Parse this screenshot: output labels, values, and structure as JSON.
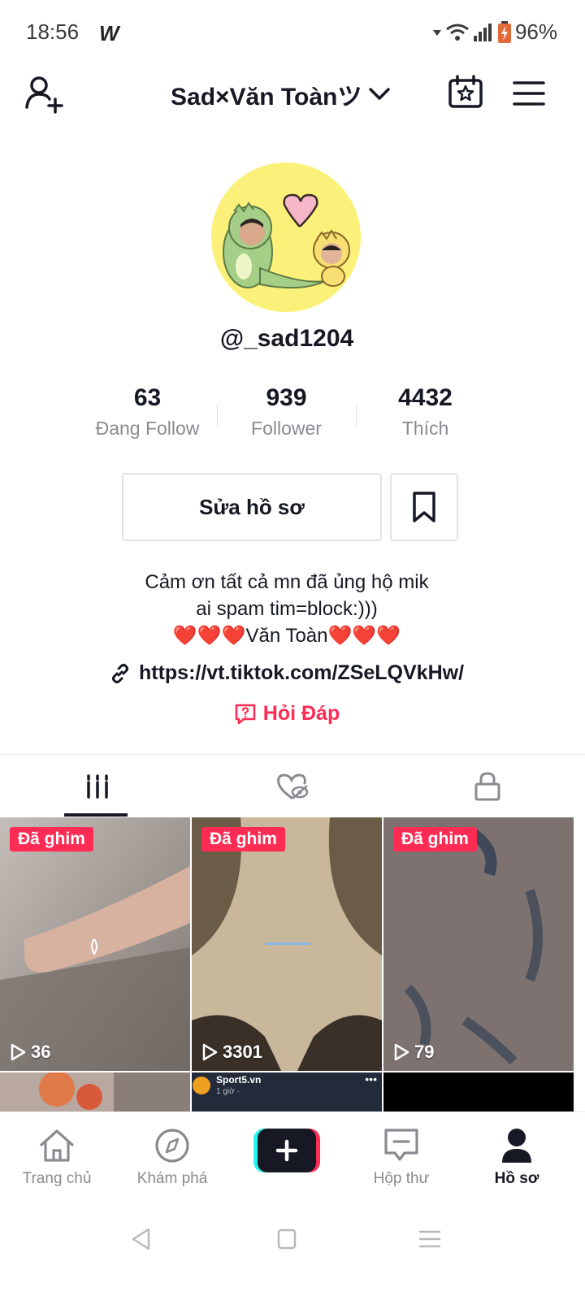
{
  "status_bar": {
    "time": "18:56",
    "app_icon": "W",
    "battery": "96%"
  },
  "header": {
    "title": "Sad×Văn Toànツ"
  },
  "profile": {
    "username": "@_sad1204",
    "stats": [
      {
        "value": "63",
        "label": "Đang Follow"
      },
      {
        "value": "939",
        "label": "Follower"
      },
      {
        "value": "4432",
        "label": "Thích"
      }
    ],
    "edit_button": "Sửa hồ sơ",
    "bio_lines": [
      "Cảm ơn tất cả mn đã ủng hộ mik",
      "ai spam tim=block:)))"
    ],
    "bio_line3_hearts_left": "❤️❤️❤️",
    "bio_line3_text": "Văn Toàn",
    "bio_line3_hearts_right": "❤️❤️❤️",
    "link": "https://vt.tiktok.com/ZSeLQVkHw/",
    "qa_label": "Hỏi Đáp"
  },
  "tabs": [
    {
      "icon": "grid-icon",
      "active": true
    },
    {
      "icon": "liked-hidden-icon",
      "active": false
    },
    {
      "icon": "lock-icon",
      "active": false
    }
  ],
  "videos": [
    {
      "pinned_label": "Đã ghim",
      "views": "36"
    },
    {
      "pinned_label": "Đã ghim",
      "views": "3301"
    },
    {
      "pinned_label": "Đã ghim",
      "views": "79"
    }
  ],
  "partial_row": {
    "account_name": "Sport5.vn",
    "time_text": "1 giờ ·"
  },
  "bottom_nav": [
    {
      "label": "Trang chủ",
      "icon": "home-icon"
    },
    {
      "label": "Khám phá",
      "icon": "compass-icon"
    },
    {
      "label": "Hộp thư",
      "icon": "inbox-icon"
    },
    {
      "label": "Hồ sơ",
      "icon": "profile-icon",
      "active": true
    }
  ],
  "colors": {
    "accent": "#fe2c55",
    "text": "#161823",
    "muted": "#8a8b91"
  }
}
